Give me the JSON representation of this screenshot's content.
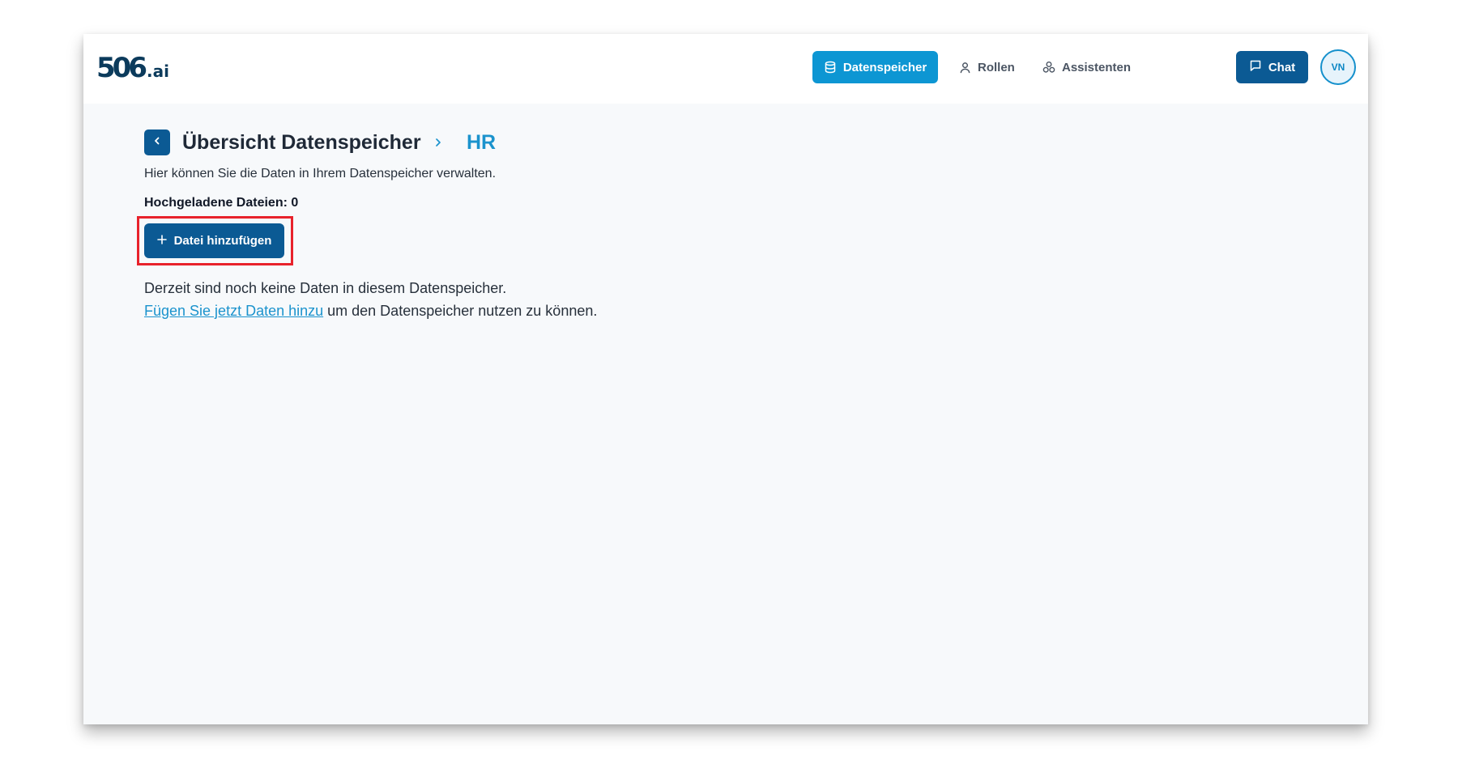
{
  "header": {
    "logo_main": "506",
    "logo_suffix": ".ai",
    "nav": [
      {
        "label": "Datenspeicher",
        "icon": "database-icon",
        "active": true
      },
      {
        "label": "Rollen",
        "icon": "user-icon",
        "active": false
      },
      {
        "label": "Assistenten",
        "icon": "assistants-icon",
        "active": false
      }
    ],
    "chat_label": "Chat",
    "avatar_initials": "VN"
  },
  "page": {
    "title": "Übersicht Datenspeicher",
    "breadcrumb_current": "HR",
    "subtitle": "Hier können Sie die Daten in Ihrem Datenspeicher verwalten.",
    "files_label": "Hochgeladene Dateien: 0",
    "add_button_label": "Datei hinzufügen",
    "empty_text": "Derzeit sind noch keine Daten in diesem Datenspeicher.",
    "empty_link": "Fügen Sie jetzt Daten hinzu",
    "empty_suffix": " um den Datenspeicher nutzen zu können."
  },
  "colors": {
    "primary": "#0b5a94",
    "accent": "#0d96d3",
    "highlight_border": "#e8222b",
    "background": "#f7f9fb"
  }
}
